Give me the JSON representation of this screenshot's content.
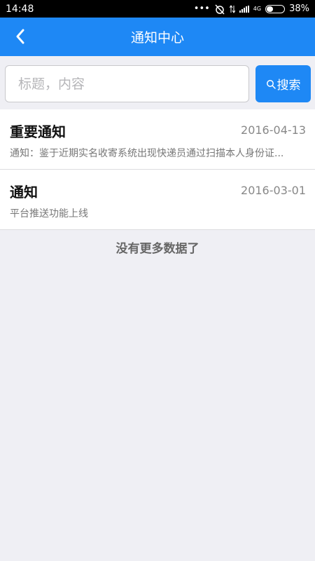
{
  "status_bar": {
    "time": "14:48",
    "network": "4G",
    "battery_percent": "38%",
    "battery_level": 0.38
  },
  "nav": {
    "title": "通知中心",
    "back_icon": "chevron-left-icon"
  },
  "search": {
    "placeholder": "标题，内容",
    "value": "",
    "button_label": "搜索",
    "button_icon": "search-icon"
  },
  "notices": [
    {
      "title": "重要通知",
      "date": "2016-04-13",
      "summary": "通知：鉴于近期实名收寄系统出现快递员通过扫描本人身份证..."
    },
    {
      "title": "通知",
      "date": "2016-03-01",
      "summary": "平台推送功能上线"
    }
  ],
  "footer": {
    "no_more_text": "没有更多数据了"
  },
  "colors": {
    "primary": "#1e88f5",
    "background": "#efeff4"
  }
}
